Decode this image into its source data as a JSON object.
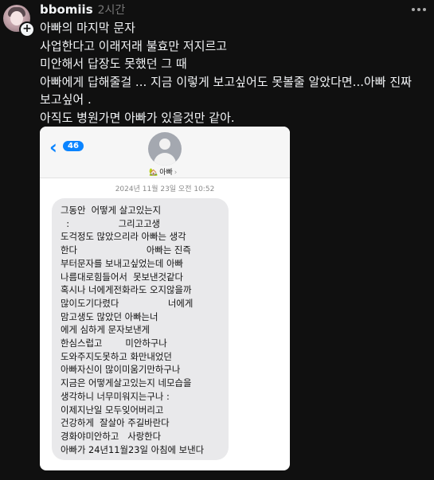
{
  "post": {
    "username": "bbomiis",
    "time": "2시간",
    "text_lines": [
      "아빠의 마지막 문자",
      "사업한다고 이래저래 불효만 저지르고",
      "미안해서 답장도 못했던 그 때",
      "아빠에게 답해줄걸 ... 지금 이렇게 보고싶어도 못볼줄 알았다면...아빠 진짜 보고싶어 .",
      "아직도 병원가면 아빠가 있을것만 같아."
    ]
  },
  "screenshot": {
    "back_badge": "46",
    "contact_name": "아빠",
    "timestamp": "2024년 11월 23일 오전 10:52",
    "message_lines": [
      "그동안  어떻게 살고있는지",
      "  :                 그리고고생",
      "도걱정도 많았으리라 아빠는 생각",
      "한다                        아빠는 진즉",
      "부터문자를 보내고싶었는데 아빠",
      "나름대로힘들어서  못보낸것같다",
      "혹시나 너에게전화라도 오지않을까",
      "많이도기다렸다                 너에게",
      "맘고생도 많았던 아빠는너",
      "에게 심하게 문자보낸게",
      "한심스럽고        미안하구나",
      "도와주지도못하고 화만내었던",
      "아빠자신이 많이미움기만하구나",
      "지금은 어떻게살고있는지 네모습을",
      "생각하니 너무미워지는구나 :",
      "이제지난일 모두잊어버리고",
      "건강하게  잘살아 주길바란다",
      "경화야미안하고   사랑한다",
      "아빠가 24년11월23일 아침에 보낸다"
    ]
  },
  "icons": {
    "avatar": "profile-photo",
    "plus": "follow-plus-icon",
    "more": "more-horizontal-icon",
    "back": "chevron-left-icon",
    "contact": "person-silhouette-icon",
    "house": "house-emoji-icon"
  },
  "colors": {
    "background": "#101010",
    "text": "#f3f5f7",
    "muted": "#777777",
    "ios_blue": "#0a84ff",
    "bubble": "#e9e9eb"
  }
}
